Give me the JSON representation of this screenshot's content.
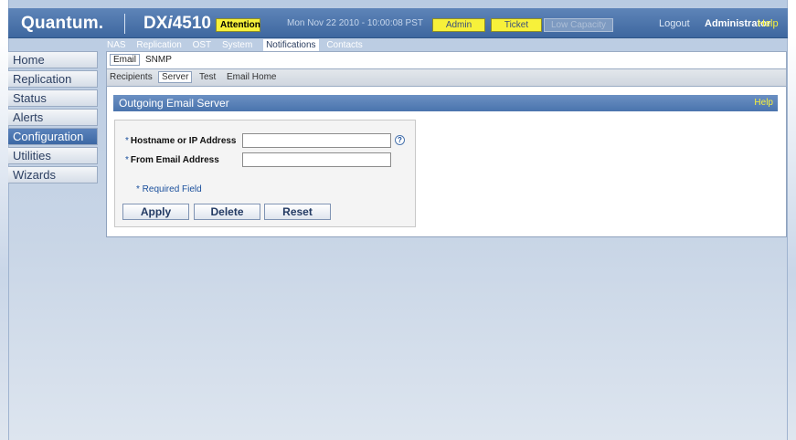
{
  "header": {
    "brand": "Quantum.",
    "model_prefix": "DX",
    "model_slash": "i",
    "model_number": "4510",
    "attention_label": "Attention",
    "datetime": "Mon Nov 22 2010 - 10:00:08 PST",
    "admin_label": "Admin",
    "ticket_label": "Ticket",
    "low_capacity_label": "Low Capacity",
    "logout_label": "Logout",
    "user": "Administrator",
    "help_label": "Help"
  },
  "sidebar": {
    "items": [
      {
        "label": "Home"
      },
      {
        "label": "Replication"
      },
      {
        "label": "Status"
      },
      {
        "label": "Alerts"
      },
      {
        "label": "Configuration",
        "active": true
      },
      {
        "label": "Utilities"
      },
      {
        "label": "Wizards"
      }
    ]
  },
  "tabs_level1": [
    "NAS",
    "Replication",
    "OST",
    "System",
    "Notifications",
    "Contacts"
  ],
  "tabs_level1_selected": "Notifications",
  "tabs_level2": [
    "Email",
    "SNMP"
  ],
  "tabs_level2_selected": "Email",
  "tabs_level3": [
    "Recipients",
    "Server",
    "Test",
    "Email Home"
  ],
  "tabs_level3_selected": "Server",
  "panel": {
    "title": "Outgoing Email Server",
    "help_label": "Help"
  },
  "form": {
    "hostname_label": "Hostname or IP Address",
    "hostname_value": "",
    "from_label": "From Email Address",
    "from_value": "",
    "required_star": "*",
    "help_glyph": "?",
    "required_note": "* Required Field",
    "apply_label": "Apply",
    "delete_label": "Delete",
    "reset_label": "Reset"
  },
  "colors": {
    "header_bg": "#4a74ad",
    "attention_bg": "#f7f13a",
    "active_nav": "#4a74ad"
  }
}
